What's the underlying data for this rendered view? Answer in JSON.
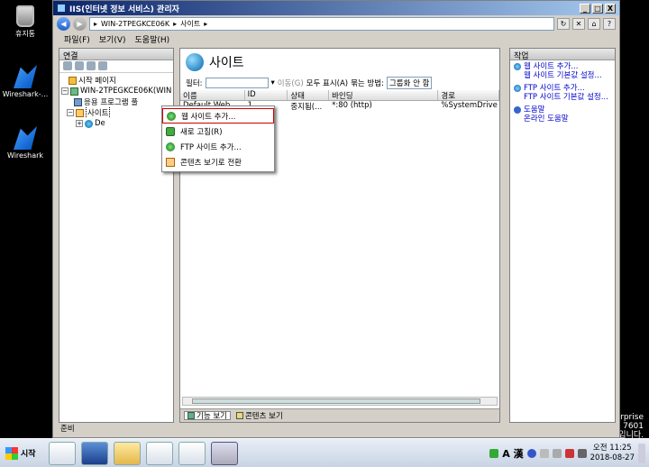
{
  "desktop": {
    "icons": [
      {
        "label": "휴지통"
      },
      {
        "label": "Wireshark-..."
      },
      {
        "label": "Wireshark"
      }
    ],
    "watermark": [
      "erprise",
      "드 7601",
      "입니다."
    ]
  },
  "window": {
    "title": "IIS(인터넷 정보 서비스) 관리자",
    "buttons": [
      "_",
      "□",
      "X"
    ],
    "address": {
      "crumbs": [
        "WIN-2TPEGKCE06K",
        "사이트"
      ],
      "separator": "▸"
    },
    "menu": [
      "파일(F)",
      "보기(V)",
      "도움말(H)"
    ]
  },
  "left_panel": {
    "header": "연결",
    "tree": [
      {
        "label": "시작 페이지",
        "indent": 1
      },
      {
        "label": "WIN-2TPEGKCE06K(WIN",
        "indent": 1
      },
      {
        "label": "응용 프로그램 풀",
        "indent": 2
      },
      {
        "label": "사이트",
        "indent": 2
      },
      {
        "label": "De",
        "indent": 3
      }
    ]
  },
  "center": {
    "title": "사이트",
    "filter_label": "필터:",
    "go_label": "이동(G)",
    "show_all_label": "모두 표시(A)",
    "group_label": "묶는 방법:",
    "group_value": "그룹화 안 함",
    "columns": [
      "이름",
      "ID",
      "상태",
      "바인딩",
      "경로"
    ],
    "rows": [
      [
        "Default Web...",
        "1",
        "중지됨(...",
        "*:80 (http)",
        "%SystemDrive"
      ]
    ],
    "view_tabs": [
      "기능 보기",
      "콘텐츠 보기"
    ]
  },
  "context_menu": {
    "items": [
      "웹 사이트 추가...",
      "새로 고침(R)",
      "FTP 사이트 추가...",
      "콘텐츠 보기로 전환"
    ]
  },
  "right_panel": {
    "header": "작업",
    "actions": [
      {
        "lines": [
          "웹 사이트 추가...",
          "웹 사이트 기본값 설정..."
        ]
      },
      {
        "lines": [
          "FTP 사이트 추가...",
          "FTP 사이트 기본값 설정..."
        ]
      },
      {
        "lines": [
          "도움말",
          "온라인 도움말"
        ]
      }
    ]
  },
  "status_bar": "준비",
  "taskbar": {
    "start_label": "시작",
    "ime_label": "A 漢",
    "clock_time": "오전 11:25",
    "clock_date": "2018-08-27"
  }
}
